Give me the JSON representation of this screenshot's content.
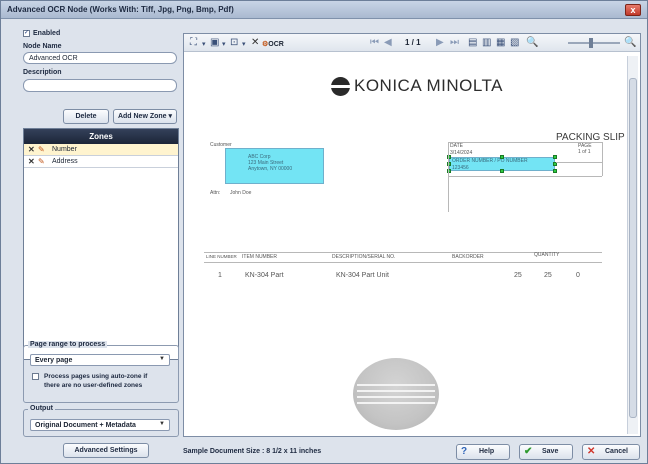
{
  "window": {
    "title": "Advanced OCR Node   (Works With: Tiff, Jpg, Png, Bmp, Pdf)",
    "close_label": "x"
  },
  "left_panel": {
    "enabled_label": "Enabled",
    "enabled_checked": true,
    "node_name_label": "Node Name",
    "node_name_value": "Advanced OCR",
    "description_label": "Description",
    "description_value": "",
    "delete_button": "Delete",
    "add_zone_button": "Add New Zone",
    "zones_header": "Zones",
    "zones": [
      {
        "name": "Number",
        "selected": true
      },
      {
        "name": "Address",
        "selected": false
      }
    ],
    "page_range": {
      "title": "Page range to process",
      "selected": "Every page",
      "auto_zone_label_1": "Process pages using auto-zone if",
      "auto_zone_label_2": "there are no user-defined zones",
      "auto_zone_checked": false
    },
    "output": {
      "title": "Output",
      "selected": "Original Document + Metadata"
    },
    "advanced_settings_button": "Advanced Settings"
  },
  "toolbar": {
    "ocr_label": "OCR",
    "page_counter": "1 / 1"
  },
  "document": {
    "brand": "KONICA MINOLTA",
    "slip_title": "PACKING SLIP",
    "customer_label": "Customer",
    "customer_lines": [
      "ABC Corp",
      "123 Main Street",
      "Anytown, NY 00000"
    ],
    "attn_label": "Attn:",
    "attn_value": "John Doe",
    "date_label": "DATE",
    "page_label": "PAGE",
    "page_value": "1 of 1",
    "date_value": "3/14/2024",
    "order_label": "ORDER NUMBER / PO NUMBER",
    "order_value": "123456",
    "table_headers": [
      "LINE NUMBER",
      "ITEM NUMBER",
      "DESCRIPTION/SERIAL NO.",
      "BACKORDER",
      "QUANTITY"
    ],
    "row": {
      "line": "1",
      "item": "KN-304 Part",
      "desc": "KN-304 Part Unit",
      "q1": "25",
      "q2": "25",
      "q3": "0"
    }
  },
  "footer": {
    "sample_size": "Sample Document Size : 8 1/2 x 11 inches",
    "help_button": "Help",
    "save_button": "Save",
    "cancel_button": "Cancel"
  },
  "colors": {
    "zone_highlight": "#00cdeb",
    "zones_header": "#1c2538",
    "selected_row": "#fff4cf"
  }
}
